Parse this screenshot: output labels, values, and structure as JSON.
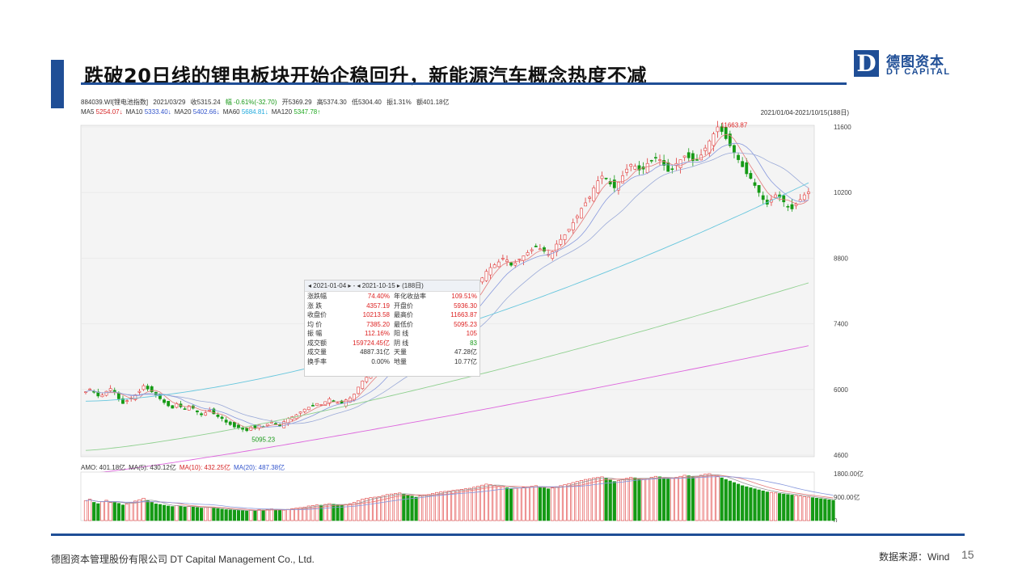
{
  "slide": {
    "title": "跌破20日线的锂电板块开始企稳回升，新能源汽车概念热度不减",
    "logo_mark": "D",
    "logo_cn": "德图资本",
    "logo_en": "DT CAPITAL",
    "footer_left": "德图资本管理股份有限公司 DT Capital Management Co., Ltd.",
    "footer_right": "数据来源：Wind",
    "page_number": "15",
    "accent_color": "#1f4e96"
  },
  "quote": {
    "code": "884039.WI[锂电池指数]",
    "date": "2021/03/29",
    "close": "收5315.24",
    "change": "幅 -0.61%(-32.70)",
    "open": "开5369.29",
    "high": "高5374.30",
    "low": "低5304.40",
    "amplitude": "振1.31%",
    "amount": "额401.18亿",
    "range_label": "2021/01/04-2021/10/15(188日)"
  },
  "ma_legend": [
    {
      "label": "MA5",
      "value": "5254.07↓",
      "color": "#d62728"
    },
    {
      "label": "MA10",
      "value": "5333.40↓",
      "color": "#3355cc"
    },
    {
      "label": "MA20",
      "value": "5402.66↓",
      "color": "#3355cc"
    },
    {
      "label": "MA60",
      "value": "5684.81↓",
      "color": "#22aadd"
    },
    {
      "label": "MA120",
      "value": "5347.78↑",
      "color": "#22aa22"
    }
  ],
  "volume_legend": [
    {
      "label": "AMO: 401.18亿",
      "color": "#333333"
    },
    {
      "label": "MA(5): 430.12亿",
      "color": "#333333"
    },
    {
      "label": "MA(10): 432.25亿",
      "color": "#d62728"
    },
    {
      "label": "MA(20): 487.38亿",
      "color": "#3355cc"
    }
  ],
  "stats_panel": {
    "header": "◂ 2021-01-04 ▸ - ◂ 2021-10-15 ▸ (188日)",
    "rows": [
      {
        "k1": "涨跌幅",
        "v1": "74.40%",
        "k2": "年化收益率",
        "v2": "109.51%"
      },
      {
        "k1": "涨 跌",
        "v1": "4357.19",
        "k2": "开盘价",
        "v2": "5936.30"
      },
      {
        "k1": "收盘价",
        "v1": "10213.58",
        "k2": "最高价",
        "v2": "11663.87"
      },
      {
        "k1": "均 价",
        "v1": "7385.20",
        "k2": "最低价",
        "v2": "5095.23"
      },
      {
        "k1": "振 幅",
        "v1": "112.16%",
        "k2": "阳 线",
        "v2": "105"
      },
      {
        "k1": "成交额",
        "v1": "159724.45亿",
        "k2": "阴 线",
        "v2": "83"
      },
      {
        "k1": "成交量",
        "v1": "4887.31亿",
        "k2": "天量",
        "v2": "47.28亿"
      },
      {
        "k1": "换手率",
        "v1": "0.00%",
        "k2": "地量",
        "v2": "10.77亿"
      }
    ]
  },
  "chart_data": [
    {
      "type": "candlestick",
      "title": "884039.WI[锂电池指数]",
      "x_range": [
        "2021-01-04",
        "2021-10-15"
      ],
      "ylim": [
        4600,
        11600
      ],
      "y_ticks": [
        "11600",
        "10200",
        "8800",
        "7400",
        "6000",
        "4600"
      ],
      "annotations": [
        {
          "text": "11663.87",
          "note": "highest price"
        },
        {
          "text": "5095.23",
          "note": "lowest price"
        }
      ],
      "key_points": [
        {
          "x": "2021-01-04",
          "open": 5936.3
        },
        {
          "x": "low",
          "low": 5095.23
        },
        {
          "x": "high",
          "high": 11663.87
        },
        {
          "x": "2021-10-15",
          "close": 10213.58
        }
      ],
      "close_series": [
        5950,
        6010,
        5940,
        5860,
        5880,
        5960,
        6020,
        5950,
        5800,
        5700,
        5760,
        5820,
        5880,
        5960,
        6080,
        6010,
        5950,
        5880,
        5800,
        5720,
        5650,
        5600,
        5700,
        5630,
        5580,
        5650,
        5600,
        5520,
        5460,
        5500,
        5560,
        5480,
        5420,
        5380,
        5300,
        5250,
        5200,
        5180,
        5150,
        5120,
        5200,
        5180,
        5240,
        5210,
        5260,
        5300,
        5250,
        5220,
        5315,
        5380,
        5420,
        5460,
        5520,
        5580,
        5620,
        5660,
        5700,
        5680,
        5740,
        5800,
        5760,
        5720,
        5700,
        5780,
        5820,
        5900,
        6050,
        6180,
        6260,
        6320,
        6380,
        6460,
        6560,
        6720,
        6800,
        6860,
        6900,
        6880,
        6820,
        6760,
        6600,
        6700,
        6820,
        6920,
        7050,
        7200,
        7320,
        7420,
        7520,
        7600,
        7680,
        7750,
        7820,
        7900,
        8050,
        8220,
        8380,
        8520,
        8600,
        8660,
        8720,
        8800,
        8760,
        8650,
        8700,
        8780,
        8850,
        8920,
        8980,
        9040,
        9000,
        8950,
        8880,
        8940,
        9100,
        9200,
        9300,
        9420,
        9560,
        9700,
        9860,
        9980,
        10100,
        10300,
        10450,
        10550,
        10500,
        10380,
        10300,
        10420,
        10560,
        10700,
        10800,
        10760,
        10680,
        10700,
        10820,
        10880,
        10950,
        10900,
        10780,
        10650,
        10700,
        10820,
        10900,
        10980,
        10940,
        10880,
        10900,
        11000,
        11150,
        11300,
        11450,
        11600,
        11500,
        11350,
        11200,
        11050,
        10900,
        10750,
        10600,
        10500,
        10350,
        10200,
        10050,
        9950,
        10050,
        10150,
        10100,
        10000,
        9900,
        9850,
        9950,
        10050,
        10150,
        10213
      ],
      "moving_averages": [
        {
          "name": "MA60",
          "color": "#66c6dd"
        },
        {
          "name": "MA120",
          "color": "#8fd08f"
        },
        {
          "name": "MA250",
          "color": "#dd66dd"
        }
      ]
    },
    {
      "type": "bar",
      "title": "AMO",
      "ylim": [
        0,
        1800
      ],
      "y_ticks": [
        "1800.00亿",
        "900.00亿",
        "0"
      ],
      "note": "daily turnover in 亿, red=up day, green=down day",
      "values": [
        760,
        820,
        700,
        650,
        720,
        780,
        690,
        720,
        660,
        600,
        640,
        700,
        750,
        800,
        860,
        780,
        700,
        640,
        620,
        590,
        560,
        540,
        580,
        560,
        520,
        540,
        520,
        500,
        480,
        500,
        520,
        480,
        460,
        440,
        420,
        410,
        400,
        390,
        380,
        370,
        400,
        390,
        420,
        410,
        430,
        450,
        430,
        420,
        401,
        430,
        460,
        480,
        500,
        520,
        560,
        580,
        600,
        590,
        620,
        650,
        630,
        600,
        580,
        620,
        650,
        700,
        760,
        820,
        860,
        880,
        900,
        920,
        960,
        1000,
        1020,
        1040,
        1060,
        1020,
        980,
        940,
        900,
        940,
        980,
        1000,
        1040,
        1080,
        1100,
        1120,
        1140,
        1160,
        1180,
        1200,
        1220,
        1240,
        1280,
        1320,
        1360,
        1400,
        1380,
        1340,
        1320,
        1300,
        1260,
        1220,
        1240,
        1260,
        1280,
        1300,
        1320,
        1340,
        1300,
        1260,
        1220,
        1250,
        1300,
        1340,
        1380,
        1420,
        1460,
        1500,
        1540,
        1580,
        1600,
        1640,
        1660,
        1680,
        1620,
        1560,
        1500,
        1540,
        1580,
        1620,
        1660,
        1640,
        1600,
        1580,
        1620,
        1660,
        1700,
        1680,
        1640,
        1600,
        1620,
        1660,
        1700,
        1740,
        1720,
        1680,
        1700,
        1740,
        1780,
        1800,
        1760,
        1700,
        1640,
        1580,
        1520,
        1460,
        1400,
        1340,
        1300,
        1260,
        1220,
        1180,
        1140,
        1100,
        1080,
        1060,
        1040,
        1020,
        1000,
        980,
        960,
        940,
        920,
        900,
        880,
        860,
        840,
        820,
        800,
        780
      ]
    }
  ]
}
